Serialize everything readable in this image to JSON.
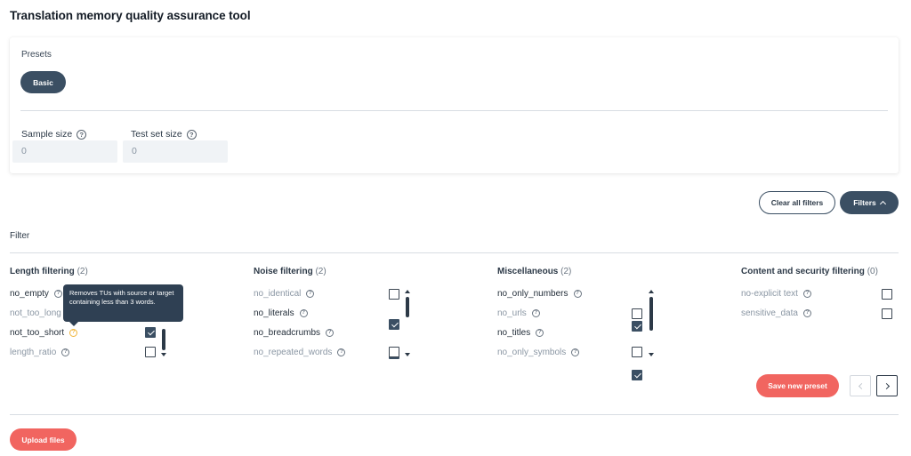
{
  "page_title": "Translation memory quality assurance tool",
  "presets": {
    "label": "Presets",
    "items": [
      "Basic"
    ]
  },
  "sample_size": {
    "label": "Sample size",
    "value": "0"
  },
  "test_set_size": {
    "label": "Test set size",
    "value": "0"
  },
  "toolbar": {
    "clear_label": "Clear all filters",
    "filters_label": "Filters"
  },
  "filter_section_label": "Filter",
  "groups": [
    {
      "title": "Length filtering",
      "count": "(2)",
      "rows": [
        {
          "label": "no_empty",
          "checked": false,
          "enabled": true
        },
        {
          "label": "not_too_long",
          "checked": false,
          "enabled": false
        },
        {
          "label": "not_too_short",
          "checked": true,
          "enabled": true
        },
        {
          "label": "length_ratio",
          "checked": false,
          "enabled": false
        }
      ]
    },
    {
      "title": "Noise filtering",
      "count": "(2)",
      "rows": [
        {
          "label": "no_identical",
          "checked": false,
          "enabled": false
        },
        {
          "label": "no_literals",
          "checked": true,
          "enabled": true
        },
        {
          "label": "no_breadcrumbs",
          "checked": true,
          "enabled": true
        },
        {
          "label": "no_repeated_words",
          "checked": false,
          "enabled": false
        }
      ]
    },
    {
      "title": "Miscellaneous",
      "count": "(2)",
      "rows": [
        {
          "label": "no_only_numbers",
          "checked": true,
          "enabled": true
        },
        {
          "label": "no_urls",
          "checked": false,
          "enabled": false
        },
        {
          "label": "no_titles",
          "checked": true,
          "enabled": true
        },
        {
          "label": "no_only_symbols",
          "checked": false,
          "enabled": false
        }
      ]
    },
    {
      "title": "Content and security filtering",
      "count": "(0)",
      "rows": [
        {
          "label": "no-explicit text",
          "checked": false,
          "enabled": false
        },
        {
          "label": "sensitive_data",
          "checked": false,
          "enabled": false
        }
      ]
    }
  ],
  "tooltip": "Removes TUs with source or target containing less than 3 words.",
  "save_preset_label": "Save new preset",
  "upload_label": "Upload files",
  "colors": {
    "primary": "#3b4f63",
    "accent": "#f16560",
    "tooltip_help": "#f0b43a"
  },
  "icons": [
    "help-icon",
    "chevron-up-icon",
    "chevron-left-icon",
    "chevron-right-icon",
    "checkbox-checked-icon"
  ]
}
